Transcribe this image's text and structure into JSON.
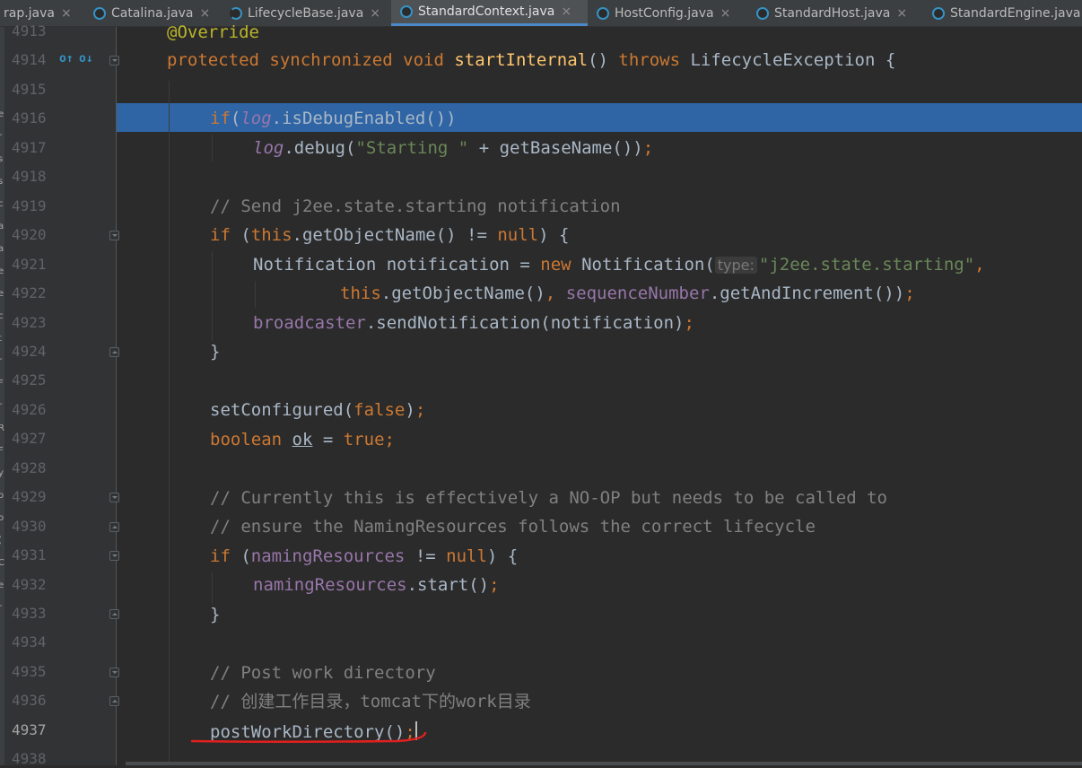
{
  "tabs": [
    {
      "label": "rap.java",
      "icon": "class-icon"
    },
    {
      "label": "Catalina.java",
      "icon": "class-icon"
    },
    {
      "label": "LifecycleBase.java",
      "icon": "abstract-class-icon"
    },
    {
      "label": "StandardContext.java",
      "icon": "class-icon",
      "active": true
    },
    {
      "label": "HostConfig.java",
      "icon": "class-icon"
    },
    {
      "label": "StandardHost.java",
      "icon": "class-icon"
    },
    {
      "label": "StandardEngine.java",
      "icon": "class-icon"
    }
  ],
  "tab_close_glyph": "×",
  "left_strip_chars": [
    "e",
    "r",
    "s",
    "s",
    "c",
    "a",
    "a",
    "e",
    "e",
    "c",
    "t",
    "r",
    "F",
    "r",
    "R",
    "F",
    "y",
    "o",
    "o",
    "(",
    "C",
    "e",
    "r"
  ],
  "gutter": {
    "line_numbers": [
      "4913",
      "4914",
      "4915",
      "4916",
      "4917",
      "4918",
      "4919",
      "4920",
      "4921",
      "4922",
      "4923",
      "4924",
      "4925",
      "4926",
      "4927",
      "4928",
      "4929",
      "4930",
      "4931",
      "4932",
      "4933",
      "4934",
      "4935",
      "4936",
      "4937",
      "4938"
    ],
    "current_line": "4937",
    "markers": [
      "overrides-method-icon",
      "implemented-icon"
    ]
  },
  "code": {
    "l4913": {
      "annotation": "@Override"
    },
    "l4914": {
      "protected": "protected",
      "synchronized": "synchronized",
      "void": "void",
      "name": "startInternal",
      "parens": "() ",
      "throws": "throws",
      "exception": " LifecycleException {"
    },
    "l4916": {
      "if": "if",
      "open": "(",
      "log": "log",
      "rest": ".isDebugEnabled())"
    },
    "l4917": {
      "log": "log",
      "call": ".debug(",
      "str": "\"Starting \"",
      "rest": " + getBaseName())",
      "semi": ";"
    },
    "l4919": {
      "comment": "// Send j2ee.state.starting notification"
    },
    "l4920": {
      "if": "if",
      "open": " (",
      "this": "this",
      "mid": ".getObjectName() != ",
      "null": "null",
      "close": ") {"
    },
    "l4921": {
      "type": "Notification notification = ",
      "new": "new",
      "ctor": " Notification(",
      "hint": "type:",
      "str": "\"j2ee.state.starting\"",
      "comma": ","
    },
    "l4922": {
      "this": "this",
      "mid": ".getObjectName()",
      "comma": ", ",
      "field": "sequenceNumber",
      "rest": ".getAndIncrement())",
      "semi": ";"
    },
    "l4923": {
      "field": "broadcaster",
      "rest": ".sendNotification(notification)",
      "semi": ";"
    },
    "l4924": {
      "brace": "}"
    },
    "l4926": {
      "call": "setConfigured(",
      "false": "false",
      "close": ")",
      "semi": ";"
    },
    "l4927": {
      "boolean": "boolean",
      "sp": " ",
      "var": "ok",
      "eq": " = ",
      "true": "true",
      "semi": ";"
    },
    "l4929": {
      "comment": "// Currently this is effectively a NO-OP but needs to be called to"
    },
    "l4930": {
      "comment": "// ensure the NamingResources follows the correct lifecycle"
    },
    "l4931": {
      "if": "if",
      "open": " (",
      "field": "namingResources",
      "mid": " != ",
      "null": "null",
      "close": ") {"
    },
    "l4932": {
      "field": "namingResources",
      "rest": ".start()",
      "semi": ";"
    },
    "l4933": {
      "brace": "}"
    },
    "l4935": {
      "comment": "// Post work directory"
    },
    "l4936": {
      "comment": "// 创建工作目录，tomcat下的work目录"
    },
    "l4937": {
      "call": "postWorkDirectory()",
      "semi": ";"
    }
  },
  "colors": {
    "background": "#2b2b2b",
    "keyword": "#cc7832",
    "method_decl": "#ffc66d",
    "field": "#9876aa",
    "string": "#6a8759",
    "comment": "#808080",
    "selection": "#2f65a5",
    "annotation_mark": "#e0201e"
  }
}
